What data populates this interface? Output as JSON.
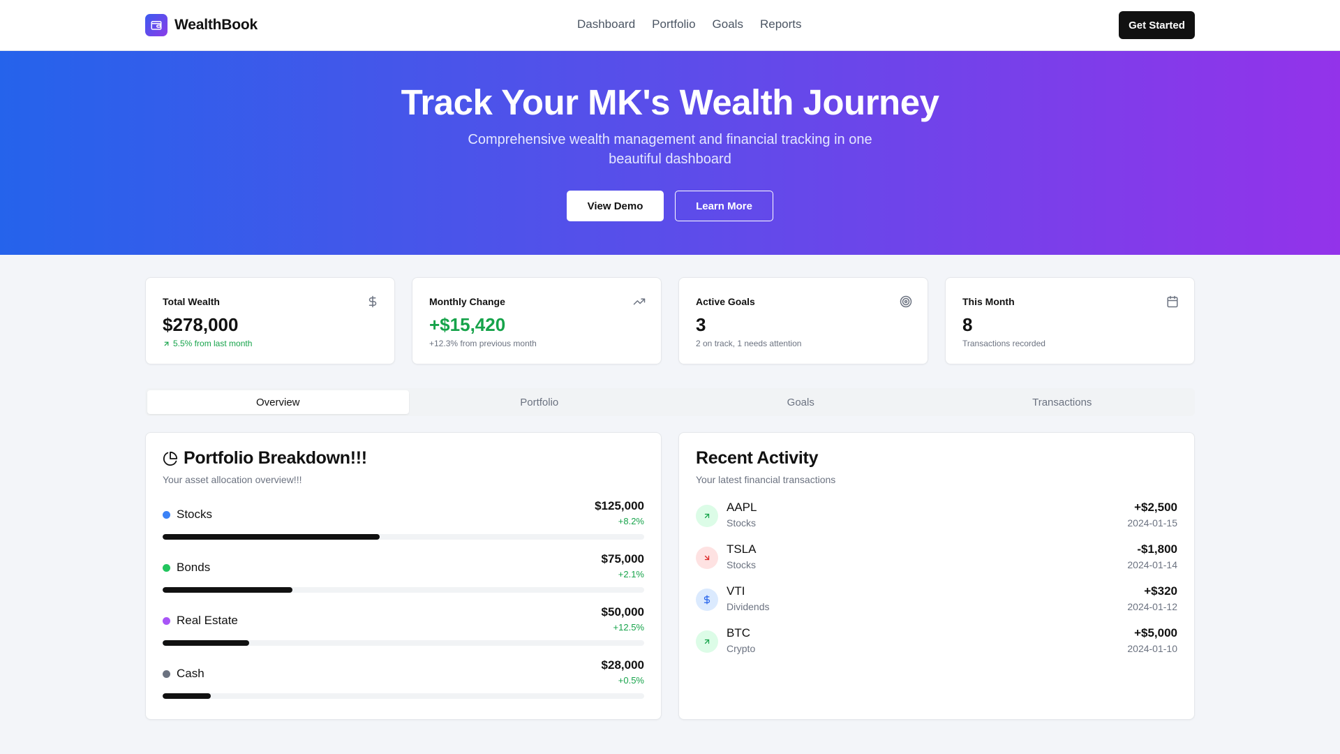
{
  "nav": {
    "brand": "WealthBook",
    "links": [
      "Dashboard",
      "Portfolio",
      "Goals",
      "Reports"
    ],
    "cta": "Get Started"
  },
  "hero": {
    "title": "Track Your MK's Wealth Journey",
    "subtitle": "Comprehensive wealth management and financial tracking in one beautiful dashboard",
    "primary_button": "View Demo",
    "secondary_button": "Learn More"
  },
  "stats": [
    {
      "label": "Total Wealth",
      "value": "$278,000",
      "note": "5.5% from last month",
      "icon": "dollar-icon"
    },
    {
      "label": "Monthly Change",
      "value": "+$15,420",
      "note": "+12.3% from previous month",
      "icon": "trending-up-icon"
    },
    {
      "label": "Active Goals",
      "value": "3",
      "note": "2 on track, 1 needs attention",
      "icon": "target-icon"
    },
    {
      "label": "This Month",
      "value": "8",
      "note": "Transactions recorded",
      "icon": "calendar-icon"
    }
  ],
  "tabs": [
    "Overview",
    "Portfolio",
    "Goals",
    "Transactions"
  ],
  "portfolio": {
    "title": "Portfolio Breakdown!!!",
    "subtitle": "Your asset allocation overview!!!",
    "assets": [
      {
        "name": "Stocks",
        "amount": "$125,000",
        "change": "+8.2%",
        "color": "#3b82f6",
        "share": 0.45
      },
      {
        "name": "Bonds",
        "amount": "$75,000",
        "change": "+2.1%",
        "color": "#22c55e",
        "share": 0.27
      },
      {
        "name": "Real Estate",
        "amount": "$50,000",
        "change": "+12.5%",
        "color": "#a855f7",
        "share": 0.18
      },
      {
        "name": "Cash",
        "amount": "$28,000",
        "change": "+0.5%",
        "color": "#6b7280",
        "share": 0.1
      }
    ]
  },
  "activity": {
    "title": "Recent Activity",
    "subtitle": "Your latest financial transactions",
    "items": [
      {
        "name": "AAPL",
        "category": "Stocks",
        "amount": "+$2,500",
        "date": "2024-01-15",
        "icon": "arrow-up-right-icon"
      },
      {
        "name": "TSLA",
        "category": "Stocks",
        "amount": "-$1,800",
        "date": "2024-01-14",
        "icon": "arrow-down-right-icon"
      },
      {
        "name": "VTI",
        "category": "Dividends",
        "amount": "+$320",
        "date": "2024-01-12",
        "icon": "dollar-icon"
      },
      {
        "name": "BTC",
        "category": "Crypto",
        "amount": "+$5,000",
        "date": "2024-01-10",
        "icon": "arrow-up-right-icon"
      }
    ]
  },
  "colors": {
    "accent_start": "#2563eb",
    "accent_end": "#9333ea",
    "positive": "#16a34a",
    "negative": "#dc2626"
  }
}
